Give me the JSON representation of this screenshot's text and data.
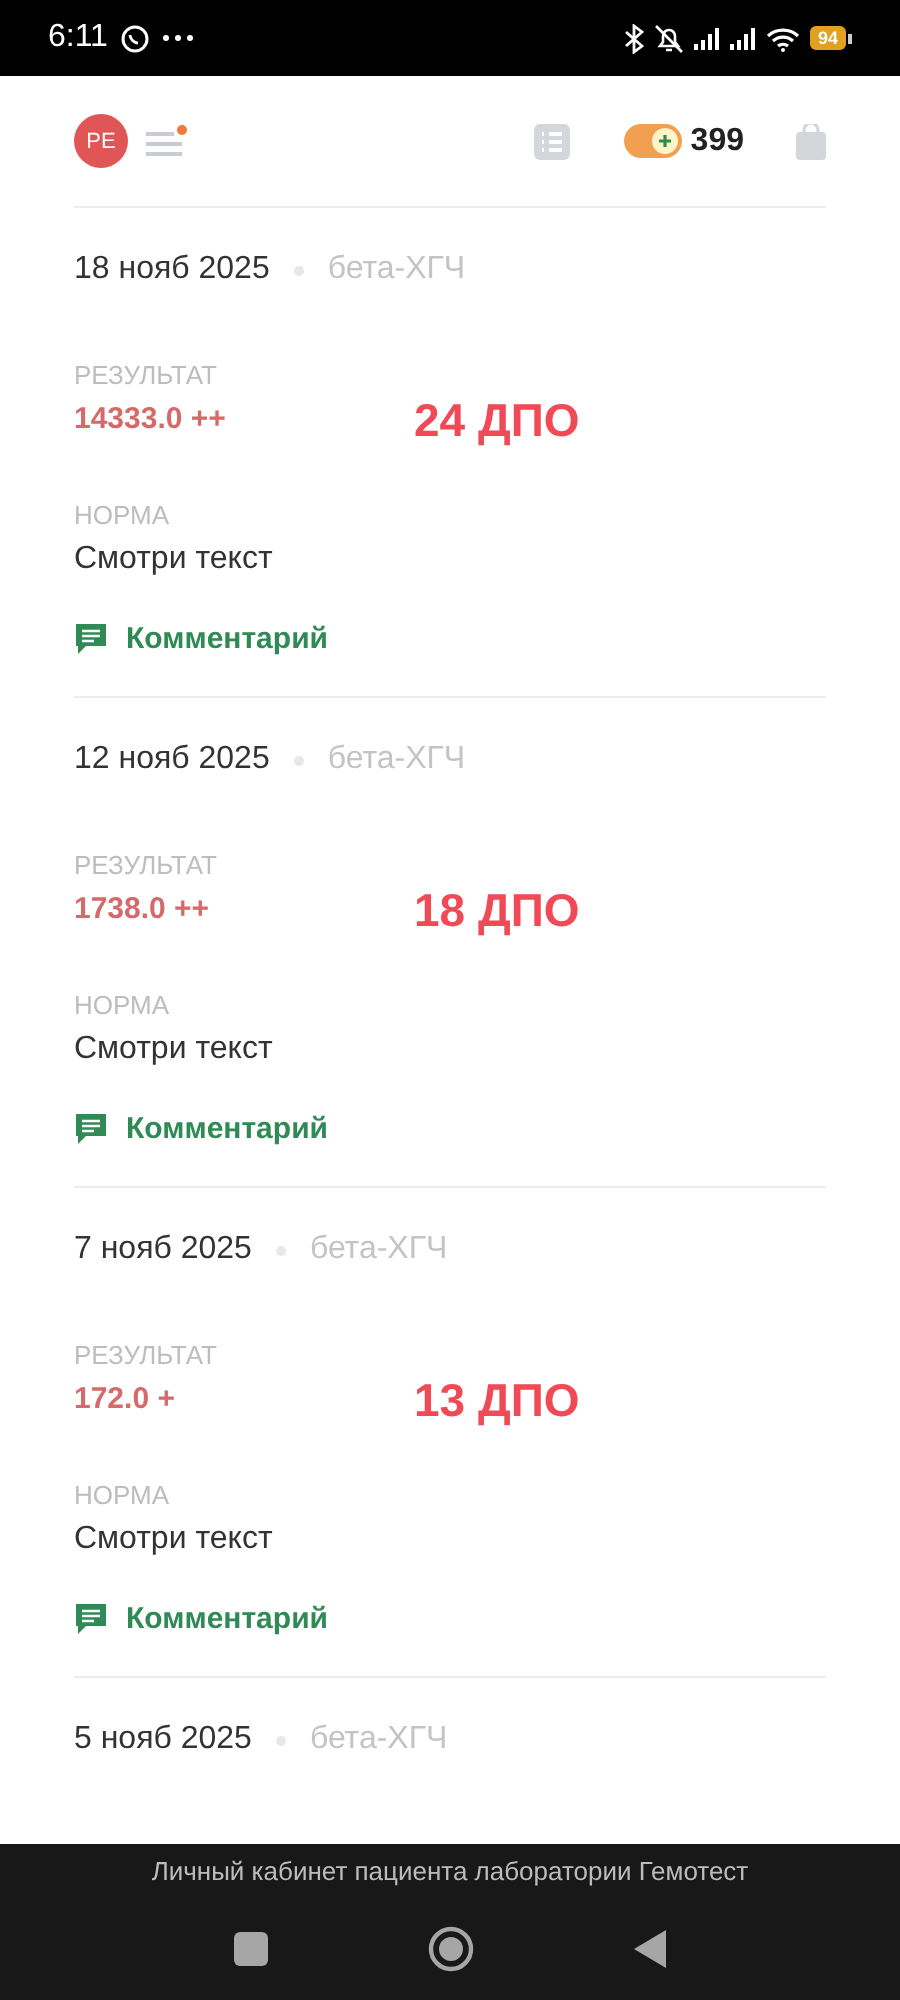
{
  "status_bar": {
    "time": "6:11",
    "battery": "94"
  },
  "header": {
    "avatar": "PE",
    "menu_notification": true,
    "points": "399"
  },
  "results": [
    {
      "date": "18 нояб 2025",
      "test": "бета-ХГЧ",
      "result_label": "РЕЗУЛЬТАТ",
      "result": "14333.0 ++",
      "annotation": "24 ДПО",
      "norm_label": "НОРМА",
      "norm": "Смотри текст",
      "comment": "Комментарий"
    },
    {
      "date": "12 нояб 2025",
      "test": "бета-ХГЧ",
      "result_label": "РЕЗУЛЬТАТ",
      "result": "1738.0 ++",
      "annotation": "18 ДПО",
      "norm_label": "НОРМА",
      "norm": "Смотри текст",
      "comment": "Комментарий"
    },
    {
      "date": "7 нояб 2025",
      "test": "бета-ХГЧ",
      "result_label": "РЕЗУЛЬТАТ",
      "result": "172.0 +",
      "annotation": "13 ДПО",
      "norm_label": "НОРМА",
      "norm": "Смотри текст",
      "comment": "Комментарий"
    },
    {
      "date": "5 нояб 2025",
      "test": "бета-ХГЧ"
    }
  ],
  "footer": {
    "caption": "Личный кабинет пациента лаборатории Гемотест"
  }
}
